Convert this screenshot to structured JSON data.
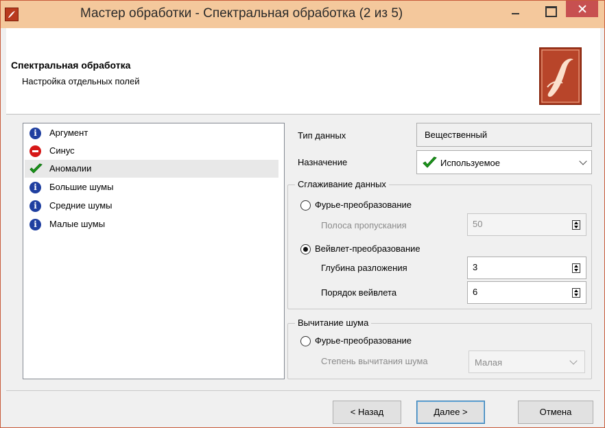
{
  "window": {
    "title": "Мастер обработки - Спектральная обработка  (2 из 5)",
    "colors": {
      "titlebar": "#f4c89c",
      "close": "#c75050",
      "logo": "#b8452a"
    }
  },
  "header": {
    "title": "Спектральная обработка",
    "subtitle": "Настройка отдельных полей"
  },
  "fields": [
    {
      "label": "Аргумент",
      "icon": "info-icon",
      "selected": false
    },
    {
      "label": "Синус",
      "icon": "stop-icon",
      "selected": false
    },
    {
      "label": "Аномалии",
      "icon": "checkmark-icon",
      "selected": true
    },
    {
      "label": "Большие шумы",
      "icon": "info-icon",
      "selected": false
    },
    {
      "label": "Средние шумы",
      "icon": "info-icon",
      "selected": false
    },
    {
      "label": "Малые шумы",
      "icon": "info-icon",
      "selected": false
    }
  ],
  "props": {
    "data_type_label": "Тип данных",
    "data_type_value": "Вещественный",
    "purpose_label": "Назначение",
    "purpose_value": "Используемое"
  },
  "smoothing": {
    "group_title": "Сглаживание данных",
    "fourier_label": "Фурье-преобразование",
    "bandwidth_label": "Полоса пропускания",
    "bandwidth_value": "50",
    "wavelet_label": "Вейвлет-преобразование",
    "depth_label": "Глубина разложения",
    "depth_value": "3",
    "order_label": "Порядок вейвлета",
    "order_value": "6"
  },
  "noise": {
    "group_title": "Вычитание шума",
    "fourier_label": "Фурье-преобразование",
    "degree_label": "Степень вычитания шума",
    "degree_value": "Малая"
  },
  "footer": {
    "back_label": "< Назад",
    "next_label": "Далее >",
    "cancel_label": "Отмена"
  }
}
